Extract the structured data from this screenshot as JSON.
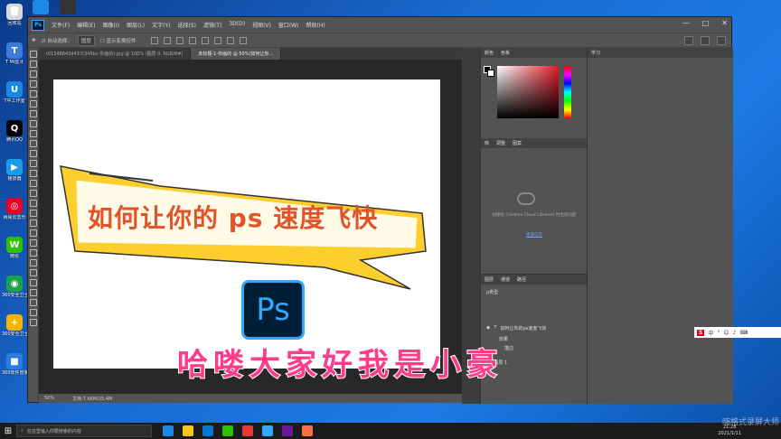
{
  "desktop": {
    "icons": [
      {
        "label": "回收站",
        "color": "#d8d8d8",
        "glyph": "🗑"
      },
      {
        "label": "T Mi蓝牙",
        "color": "#3b7ad8",
        "glyph": "T"
      },
      {
        "label": "T中工作室",
        "color": "#1a88e0",
        "glyph": "U"
      },
      {
        "label": "腾讯QQ",
        "color": "#000000",
        "glyph": "Q"
      },
      {
        "label": "播放器",
        "color": "#1c9be8",
        "glyph": "▶"
      },
      {
        "label": "网易云音乐",
        "color": "#e60026",
        "glyph": "◎"
      },
      {
        "label": "微信",
        "color": "#2dc100",
        "glyph": "W"
      },
      {
        "label": "360安全卫士",
        "color": "#1aa34a",
        "glyph": "◉"
      },
      {
        "label": "360安全卫士",
        "color": "#f5b400",
        "glyph": "+"
      },
      {
        "label": "360软件管家",
        "color": "#2a7de1",
        "glyph": "■"
      }
    ]
  },
  "photoshop": {
    "logo": "Ps",
    "menu": [
      "文件(F)",
      "编辑(E)",
      "图像(I)",
      "图层(L)",
      "文字(Y)",
      "选择(S)",
      "滤镜(T)",
      "3D(D)",
      "视图(V)",
      "窗口(W)",
      "帮助(H)"
    ],
    "window_controls": [
      "—",
      "□",
      "✕"
    ],
    "options": {
      "auto_select_label": "自动选择：",
      "auto_select_value": "图层",
      "transform_label": "显示变换控件"
    },
    "tabs": [
      {
        "label": "t01348643d437(345bc-你画的).jpg @ 100% (图层 0, RGB/8#)",
        "active": false
      },
      {
        "label": "未标题-1-你画的 @ 50%(如何让你...",
        "active": true
      }
    ],
    "status": {
      "zoom": "50%",
      "doc": "文档:7.66M/25.4M"
    },
    "canvas": {
      "banner_text": "如何让你的 ps 速度飞快",
      "logo_text": "Ps"
    },
    "panels": {
      "color_tabs": [
        "颜色",
        "色板"
      ],
      "library_tabs": [
        "库",
        "调整",
        "图案"
      ],
      "library_message": "初始化 Creative Cloud Libraries 时出现问题",
      "library_link": "更多信息",
      "layers_tabs": [
        "图层",
        "通道",
        "路径"
      ],
      "layer_filter": "ρ类型",
      "layers": [
        {
          "name": "如何让你的ps速度飞快"
        },
        {
          "name": "效果"
        },
        {
          "name": "描边"
        },
        {
          "name": "图层 1"
        }
      ],
      "history_tab": "学习"
    }
  },
  "subtitle": "哈喽大家好我是小豪",
  "ime": {
    "brand": "S",
    "label": "中"
  },
  "taskbar": {
    "search_placeholder": "在这里输入你要搜索的内容",
    "icons": [
      "#1e88e5",
      "#f5c518",
      "#0078d4",
      "#2dc100",
      "#e53935",
      "#31a8ff",
      "#6a1b9a",
      "#ff7043"
    ],
    "time": "21:28",
    "date": "2021/1/11"
  },
  "watermark": "嗨格式录屏大师"
}
